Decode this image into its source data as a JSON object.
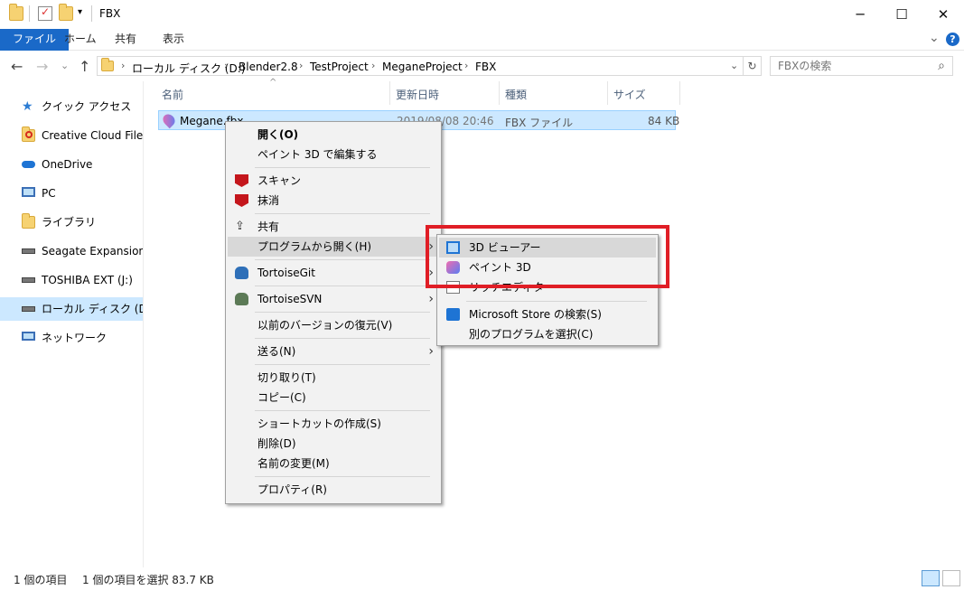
{
  "window": {
    "title": "FBX",
    "controls": {
      "minimize": "─",
      "maximize": "☐",
      "close": "✕"
    }
  },
  "ribbon": {
    "tabs": [
      {
        "label": "ファイル",
        "active": true
      },
      {
        "label": "ホーム"
      },
      {
        "label": "共有"
      },
      {
        "label": "表示"
      }
    ],
    "expand_glyph": "⌄",
    "help_glyph": "?"
  },
  "nav": {
    "back": "←",
    "forward": "→",
    "recent": "⌄",
    "up": "↑",
    "breadcrumbs": [
      "ローカル ディスク (D:)",
      "Blender2.8",
      "TestProject",
      "MeganeProject",
      "FBX"
    ],
    "address_dropdown": "⌄",
    "refresh": "↻",
    "search_placeholder": "FBXの検索",
    "search_icon": "⌕"
  },
  "sidebar": {
    "items": [
      {
        "label": "クイック アクセス",
        "icon": "star-icon"
      },
      {
        "label": "Creative Cloud Files",
        "icon": "creative-cloud-icon"
      },
      {
        "label": "OneDrive",
        "icon": "cloud-icon"
      },
      {
        "label": "PC",
        "icon": "computer-icon"
      },
      {
        "label": "ライブラリ",
        "icon": "library-icon"
      },
      {
        "label": "Seagate Expansion Dr",
        "icon": "drive-icon"
      },
      {
        "label": "TOSHIBA EXT (J:)",
        "icon": "drive-icon"
      },
      {
        "label": "ローカル ディスク (D:)",
        "icon": "drive-icon",
        "selected": true
      },
      {
        "label": "ネットワーク",
        "icon": "network-icon"
      }
    ]
  },
  "file_list": {
    "columns": [
      "名前",
      "更新日時",
      "種類",
      "サイズ"
    ],
    "sort_indicator": "^",
    "rows": [
      {
        "name": "Megane.fbx",
        "modified": "2019/08/08 20:46",
        "type": "FBX ファイル",
        "size": "84 KB"
      }
    ]
  },
  "context_menu": {
    "items": [
      {
        "label": "開く(O)",
        "bold": true
      },
      {
        "label": "ペイント 3D で編集する"
      },
      {
        "separator": true
      },
      {
        "label": "スキャン",
        "icon": "mcafee-icon"
      },
      {
        "label": "抹消",
        "icon": "mcafee-icon"
      },
      {
        "separator": true
      },
      {
        "label": "共有",
        "icon": "share-icon"
      },
      {
        "label": "プログラムから開く(H)",
        "arrow": "›",
        "highlighted": true
      },
      {
        "separator": true
      },
      {
        "label": "TortoiseGit",
        "icon": "tortoisegit-icon",
        "arrow": "›"
      },
      {
        "separator": true
      },
      {
        "label": "TortoiseSVN",
        "icon": "tortoisesvn-icon",
        "arrow": "›"
      },
      {
        "separator": true
      },
      {
        "label": "以前のバージョンの復元(V)"
      },
      {
        "separator": true
      },
      {
        "label": "送る(N)",
        "arrow": "›"
      },
      {
        "separator": true
      },
      {
        "label": "切り取り(T)"
      },
      {
        "label": "コピー(C)"
      },
      {
        "separator": true
      },
      {
        "label": "ショートカットの作成(S)"
      },
      {
        "label": "削除(D)"
      },
      {
        "label": "名前の変更(M)"
      },
      {
        "separator": true
      },
      {
        "label": "プロパティ(R)"
      }
    ]
  },
  "submenu": {
    "items": [
      {
        "label": "3D ビューアー",
        "icon": "3d-viewer-icon",
        "highlighted": true
      },
      {
        "label": "ペイント 3D",
        "icon": "paint-3d-icon"
      },
      {
        "label": "リッチエディタ",
        "icon": "rich-editor-icon"
      },
      {
        "separator": true
      },
      {
        "label": "Microsoft Store の検索(S)",
        "icon": "store-icon"
      },
      {
        "label": "別のプログラムを選択(C)"
      }
    ]
  },
  "status_bar": {
    "item_count": "1 個の項目",
    "selection": "1 個の項目を選択 83.7 KB"
  },
  "colors": {
    "ribbon_active": "#1a69c8",
    "selection": "#cce8ff",
    "highlight_box": "#e01e26"
  }
}
